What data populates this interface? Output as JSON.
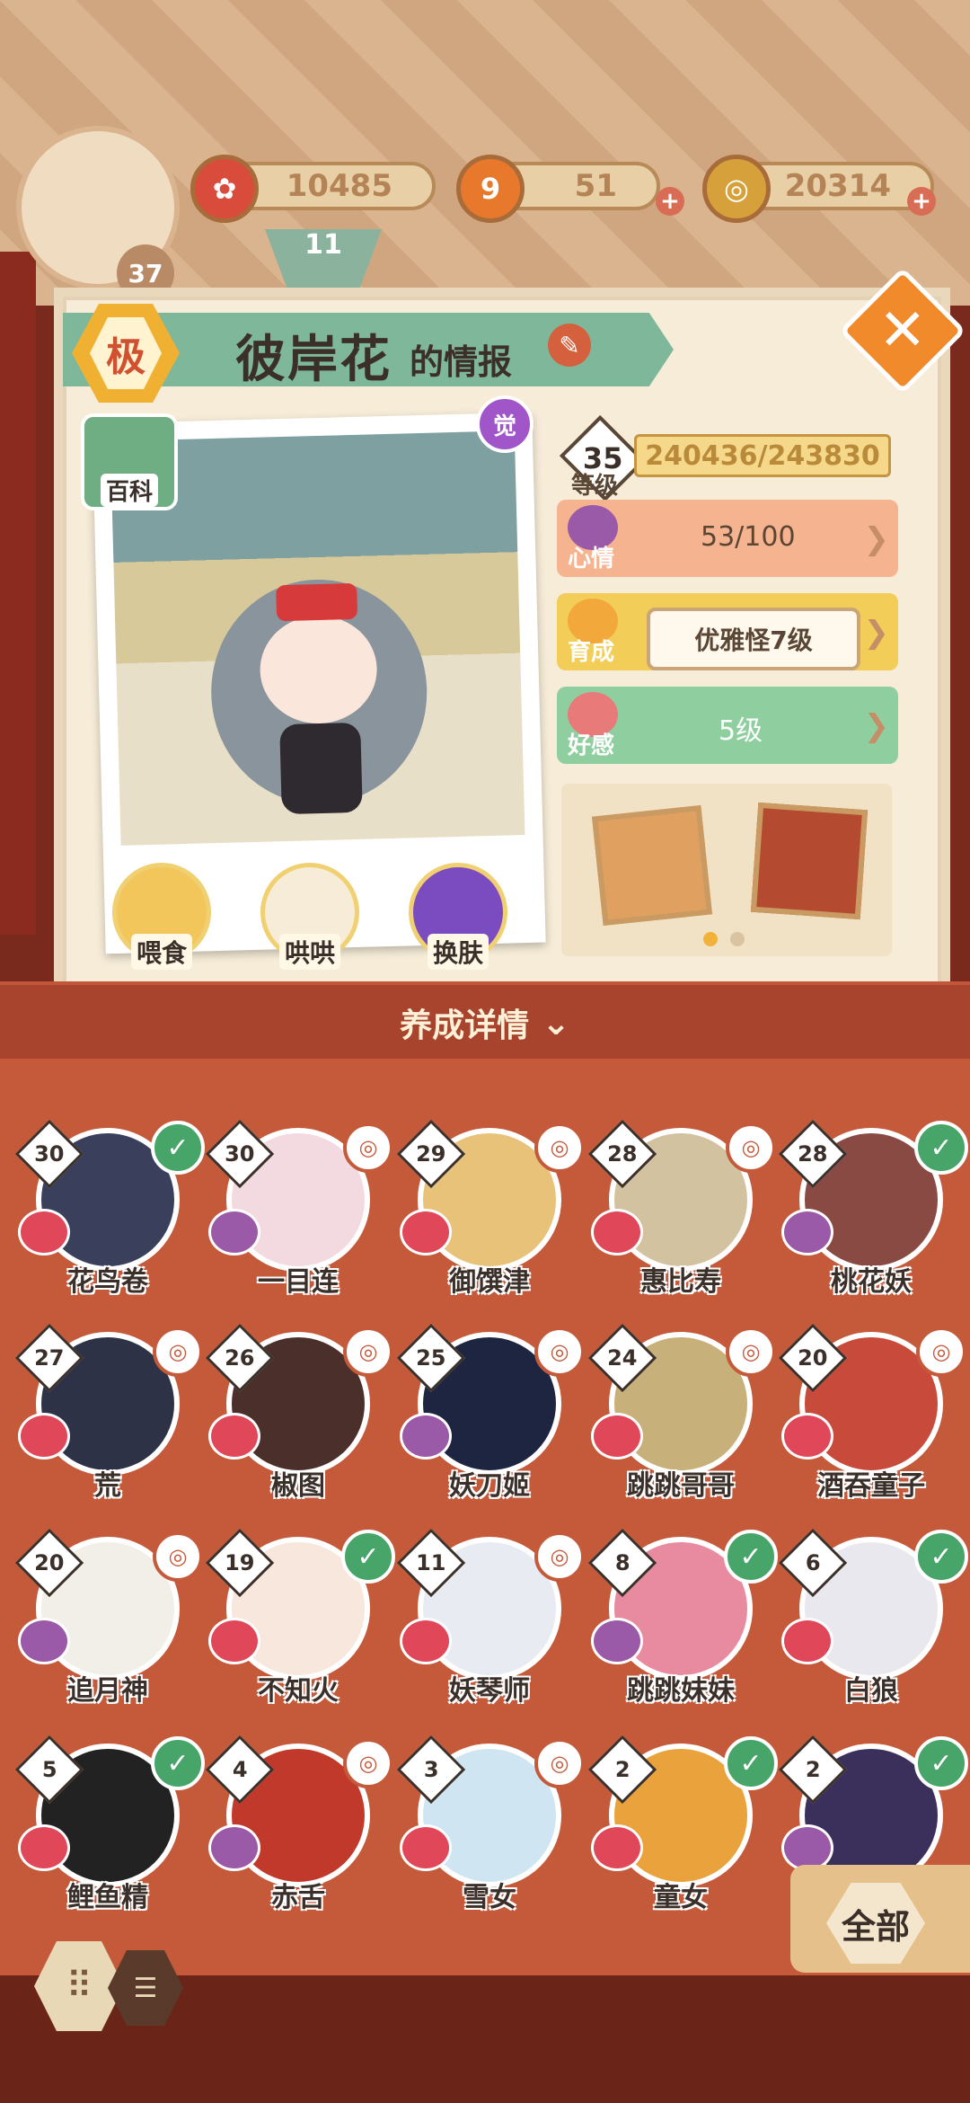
{
  "currency": {
    "player_level": "37",
    "flower": "10485",
    "fish": "51",
    "coins": "20314",
    "progress_label": "11"
  },
  "info": {
    "rank": "极",
    "name": "彼岸花",
    "name_suffix": "的情报",
    "awaken": "觉",
    "wiki_label": "百科",
    "level": "35",
    "level_label": "等级",
    "exp": "240436/243830",
    "mood_label": "心情",
    "mood": "53/100",
    "growth_label": "育成",
    "growth": "优雅怪7级",
    "favor_label": "好感",
    "favor": "5级",
    "actions": [
      "喂食",
      "哄哄",
      "换肤"
    ]
  },
  "details_label": "养成详情",
  "shikigami": [
    {
      "lv": "30",
      "name": "花鸟卷",
      "badge": "check",
      "color": "#3a3f5c"
    },
    {
      "lv": "30",
      "name": "一目连",
      "badge": "ring",
      "color": "#f3d9e0"
    },
    {
      "lv": "29",
      "name": "御馔津",
      "badge": "ring",
      "color": "#e9c27a"
    },
    {
      "lv": "28",
      "name": "惠比寿",
      "badge": "ring",
      "color": "#d2c2a0"
    },
    {
      "lv": "28",
      "name": "桃花妖",
      "badge": "check",
      "color": "#8a4a44"
    },
    {
      "lv": "27",
      "name": "荒",
      "badge": "ring",
      "color": "#2e3247"
    },
    {
      "lv": "26",
      "name": "椒图",
      "badge": "ring",
      "color": "#4b2f2a"
    },
    {
      "lv": "25",
      "name": "妖刀姬",
      "badge": "ring",
      "color": "#1e2540"
    },
    {
      "lv": "24",
      "name": "跳跳哥哥",
      "badge": "ring",
      "color": "#c8b07a"
    },
    {
      "lv": "20",
      "name": "酒吞童子",
      "badge": "ring",
      "color": "#c84a3a"
    },
    {
      "lv": "20",
      "name": "追月神",
      "badge": "ring",
      "color": "#f2efe8"
    },
    {
      "lv": "19",
      "name": "不知火",
      "badge": "check",
      "color": "#f7e7dc"
    },
    {
      "lv": "11",
      "name": "妖琴师",
      "badge": "ring",
      "color": "#e8ecf2"
    },
    {
      "lv": "8",
      "name": "跳跳妹妹",
      "badge": "check",
      "color": "#e88aa0"
    },
    {
      "lv": "6",
      "name": "白狼",
      "badge": "check",
      "color": "#e8e8ee"
    },
    {
      "lv": "5",
      "name": "鲤鱼精",
      "badge": "check",
      "color": "#222222"
    },
    {
      "lv": "4",
      "name": "赤舌",
      "badge": "ring",
      "color": "#c0392b"
    },
    {
      "lv": "3",
      "name": "雪女",
      "badge": "ring",
      "color": "#cfe6f2"
    },
    {
      "lv": "2",
      "name": "童女",
      "badge": "check",
      "color": "#e9a23c"
    },
    {
      "lv": "2",
      "name": "",
      "badge": "check",
      "color": "#3b2f5c"
    }
  ],
  "filter_label": "全部",
  "colors": {
    "accent": "#c55a3b",
    "check": "#48a56a",
    "panel": "#f6ecd8"
  }
}
